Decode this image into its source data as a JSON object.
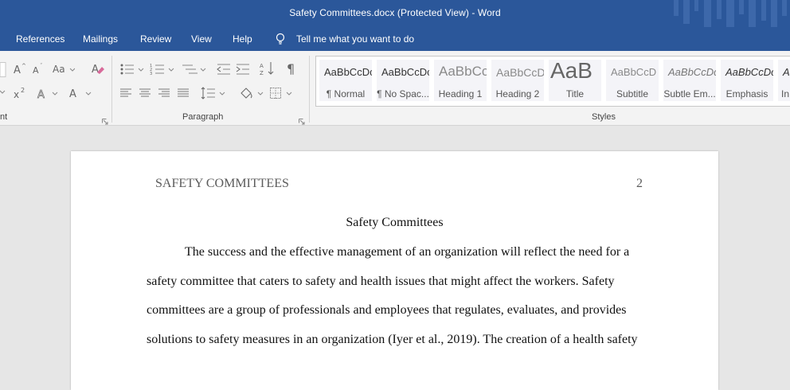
{
  "window": {
    "title": "Safety Committees.docx (Protected View)  -  Word"
  },
  "menu": {
    "tabs": [
      "References",
      "Mailings",
      "Review",
      "View",
      "Help"
    ],
    "tell_me": "Tell me what you want to do"
  },
  "ribbon": {
    "font_group_label": "nt",
    "paragraph_group_label": "Paragraph",
    "styles_group_label": "Styles",
    "styles": [
      {
        "preview": "AaBbCcDc",
        "name": "¶ Normal"
      },
      {
        "preview": "AaBbCcDc",
        "name": "¶ No Spac..."
      },
      {
        "preview": "AaBbCc",
        "name": "Heading 1"
      },
      {
        "preview": "AaBbCcD",
        "name": "Heading 2"
      },
      {
        "preview": "AaB",
        "name": "Title"
      },
      {
        "preview": "AaBbCcD",
        "name": "Subtitle"
      },
      {
        "preview": "AaBbCcDc",
        "name": "Subtle Em..."
      },
      {
        "preview": "AaBbCcDc",
        "name": "Emphasis"
      },
      {
        "preview": "AaBbCcDc",
        "name": "In"
      }
    ]
  },
  "document": {
    "running_head": "SAFETY COMMITTEES",
    "page_number": "2",
    "title": "Safety Committees",
    "lines": [
      "The success and the effective management of an organization will reflect the need for a",
      "safety committee that caters to safety and health issues that might affect the workers. Safety",
      "committees are a group of professionals and employees that regulates, evaluates, and provides",
      "solutions to safety measures in an organization (Iyer et al., 2019). The creation of a health safety"
    ]
  },
  "colors": {
    "word_blue": "#2b579a",
    "ribbon_bg": "#f3f3f3",
    "canvas_bg": "#e6e6e6"
  }
}
